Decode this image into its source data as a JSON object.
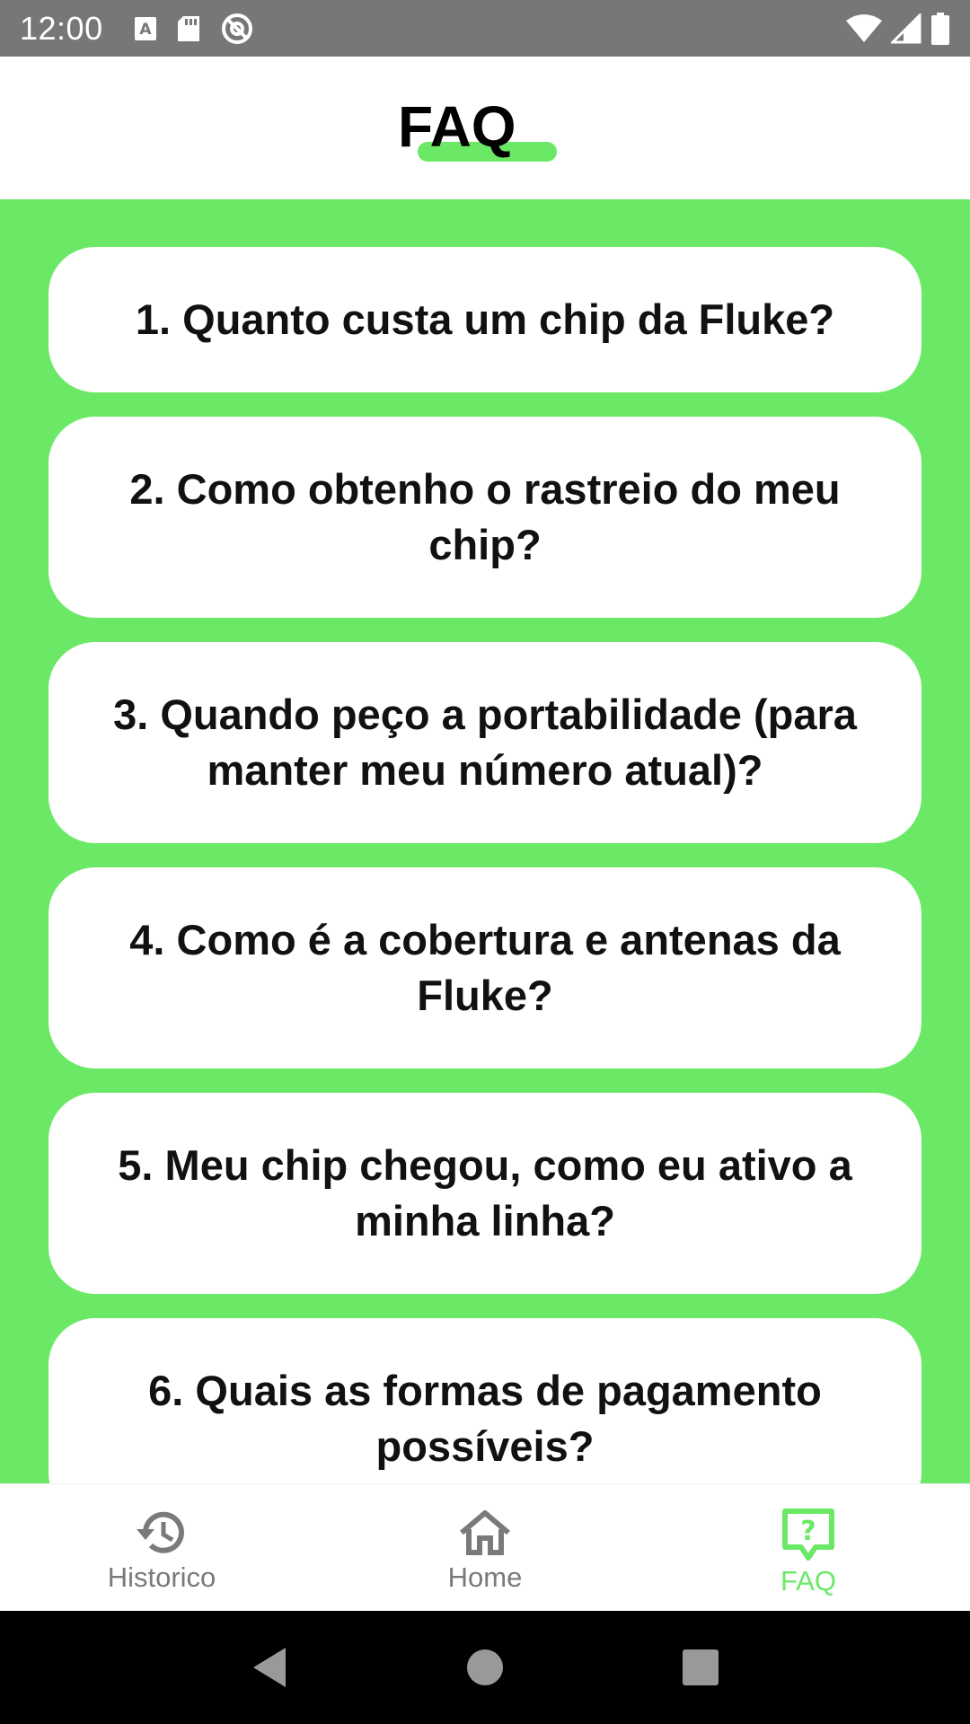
{
  "status_bar": {
    "time": "12:00",
    "left_icons": [
      "a-icon",
      "sd-card-icon",
      "no-sync-icon"
    ],
    "right_icons": [
      "wifi-icon",
      "signal-icon",
      "battery-icon"
    ]
  },
  "header": {
    "title": "FAQ",
    "accent_color": "#6be966"
  },
  "faq": {
    "items": [
      {
        "label": "1. Quanto custa um chip da Fluke?"
      },
      {
        "label": "2. Como obtenho o rastreio do meu chip?"
      },
      {
        "label": "3. Quando peço a portabilidade (para manter meu número atual)?"
      },
      {
        "label": "4. Como é a cobertura e antenas da Fluke?"
      },
      {
        "label": "5. Meu chip chegou, como eu ativo a minha linha?"
      },
      {
        "label": "6. Quais as formas de pagamento possíveis?"
      }
    ]
  },
  "bottom_nav": {
    "items": [
      {
        "label": "Historico",
        "icon": "history-icon",
        "active": false
      },
      {
        "label": "Home",
        "icon": "home-icon",
        "active": false
      },
      {
        "label": "FAQ",
        "icon": "help-chat-icon",
        "active": true
      }
    ]
  },
  "system_nav": {
    "icons": [
      "back-icon",
      "home-circle-icon",
      "recents-icon"
    ]
  },
  "colors": {
    "background_green": "#6be966",
    "status_bar": "#777777",
    "nav_inactive": "#7a7a7a"
  }
}
